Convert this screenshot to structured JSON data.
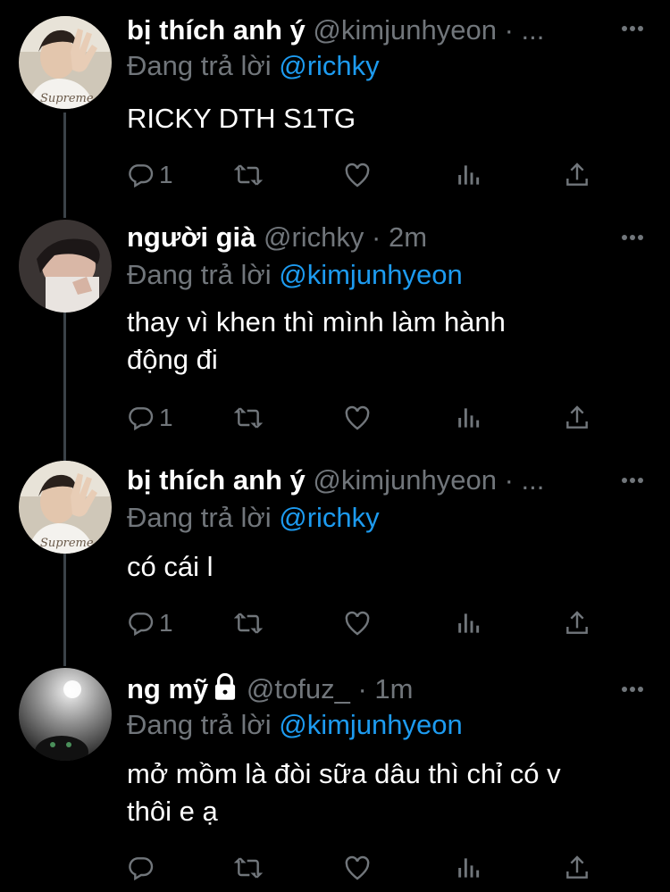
{
  "colors": {
    "background": "#000000",
    "name": "#ffffff",
    "muted": "#71767b",
    "link": "#1d9bf0",
    "thread": "#3b4248"
  },
  "tweets": [
    {
      "name": "bị thích anh ý",
      "handle": "@kimjunhyeon",
      "meta": "· ...",
      "reply_prefix": "Đang trả lời",
      "reply_to": "@richky",
      "text": [
        "RICKY DTH S1TG"
      ],
      "reply_count": "1",
      "avatar": "avatar-boy-waving",
      "locked": false
    },
    {
      "name": "người già",
      "handle": "@richky",
      "meta": "· 2m",
      "reply_prefix": "Đang trả lời",
      "reply_to": "@kimjunhyeon",
      "text": [
        "thay vì khen thì mình làm hành",
        "động đi"
      ],
      "reply_count": "1",
      "avatar": "avatar-boy-lying",
      "locked": false
    },
    {
      "name": "bị thích anh ý",
      "handle": "@kimjunhyeon",
      "meta": "· ...",
      "reply_prefix": "Đang trả lời",
      "reply_to": "@richky",
      "text": [
        "có cái l"
      ],
      "reply_count": "1",
      "avatar": "avatar-boy-waving",
      "locked": false
    },
    {
      "name": "ng mỹ",
      "handle": "@tofuz_",
      "meta": "· 1m",
      "reply_prefix": "Đang trả lời",
      "reply_to": "@kimjunhyeon",
      "text": [
        "mở mồm là đòi sữa dâu thì chỉ có v",
        "thôi e ạ"
      ],
      "reply_count": "",
      "avatar": "avatar-dark-cat",
      "locked": true
    }
  ],
  "icons": [
    "reply-icon",
    "retweet-icon",
    "like-icon",
    "analytics-icon",
    "share-icon",
    "more-icon",
    "lock-icon"
  ]
}
